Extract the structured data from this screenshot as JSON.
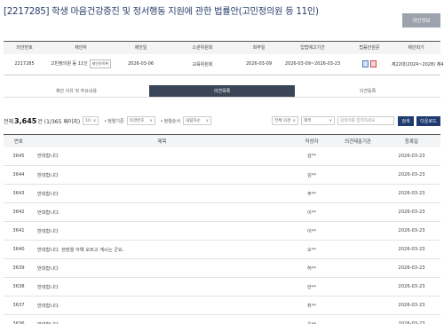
{
  "page": {
    "title": "[2217285] 학생 마음건강증진 및 정서행동 지원에 관한 법률안(고민정의원 등 11인)",
    "info_button": "의안정보"
  },
  "bill_info": {
    "headers": [
      "의안번호",
      "제안자",
      "제안일",
      "소관위원회",
      "회부일",
      "입법예고기간",
      "법률안원문",
      "제안회기"
    ],
    "values": {
      "bill_no": "2217285",
      "proposer": "고민정의원 등 11인",
      "proposer_chip": "제안자목록",
      "proposal_date": "2026-03-06",
      "committee": "교육위원회",
      "referral_date": "2026-03-09",
      "notice_period": "2026-03-09~2026-03-23",
      "original_text_icons": [
        "hwp-file-icon",
        "pdf-file-icon"
      ],
      "session": "제22대(2024~2028) 제433회"
    }
  },
  "tabs": [
    {
      "label": "제안 이유 및 주요내용",
      "active": false
    },
    {
      "label": "의견목록",
      "active": true
    },
    {
      "label": "의견등록",
      "active": false
    }
  ],
  "toolbar": {
    "total_prefix": "전체",
    "total_count": "3,645",
    "total_suffix": "건 (1/365 페이지)",
    "page_size": "10",
    "sort_criteria_label": "정렬기준",
    "sort_criteria_value": "의견번호",
    "sort_order_label": "정렬순서",
    "sort_order_value": "내림차순",
    "filter_value": "전체 의견",
    "field_value": "제목",
    "search_placeholder": "검색어를 입력하세요",
    "search_button": "검색",
    "download_button": "다운로드"
  },
  "list": {
    "headers": [
      "번호",
      "제목",
      "작성자",
      "의견제출기관",
      "등록일"
    ],
    "rows": [
      {
        "no": "3645",
        "title": "반대합니다",
        "author": "김**",
        "org": "",
        "date": "2026-03-23"
      },
      {
        "no": "3644",
        "title": "반대합니다",
        "author": "김**",
        "org": "",
        "date": "2026-03-23"
      },
      {
        "no": "3643",
        "title": "반대합니다",
        "author": "주**",
        "org": "",
        "date": "2026-03-23"
      },
      {
        "no": "3642",
        "title": "반대합니다.",
        "author": "이**",
        "org": "",
        "date": "2026-03-23"
      },
      {
        "no": "3641",
        "title": "반대합니다",
        "author": "이**",
        "org": "",
        "date": "2026-03-23"
      },
      {
        "no": "3640",
        "title": "반대합니다. 현장을 아예 모르고 계시는 군요.",
        "author": "오**",
        "org": "",
        "date": "2026-03-23"
      },
      {
        "no": "3639",
        "title": "반대합니다",
        "author": "허**",
        "org": "",
        "date": "2026-03-23"
      },
      {
        "no": "3638",
        "title": "반대합니다",
        "author": "안**",
        "org": "",
        "date": "2026-03-23"
      },
      {
        "no": "3637",
        "title": "반대합니다.",
        "author": "최**",
        "org": "",
        "date": "2026-03-23"
      },
      {
        "no": "3636",
        "title": "반대합니다",
        "author": "윤**",
        "org": "",
        "date": "2026-03-23"
      }
    ]
  }
}
